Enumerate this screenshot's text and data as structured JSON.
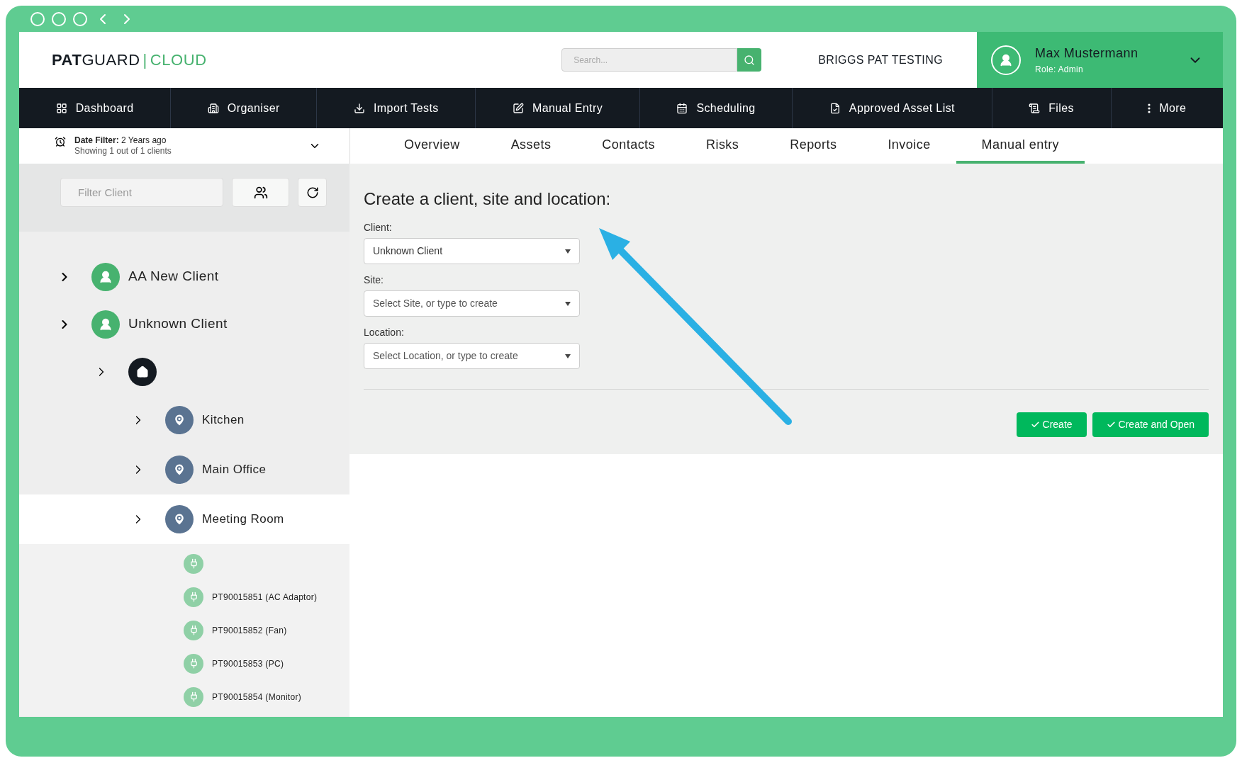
{
  "header": {
    "logo": {
      "name": "**PAT**GUARD",
      "separator": "|",
      "product": "CLOUD"
    },
    "search": {
      "placeholder": "Search..."
    },
    "company": "BRIGGS PAT TESTING",
    "user": {
      "name": "Max Mustermann",
      "role": "Role: Admin"
    }
  },
  "nav": [
    "Dashboard",
    "Organiser",
    "Import Tests",
    "Manual Entry",
    "Scheduling",
    "Approved Asset List",
    "Files",
    "More"
  ],
  "date_filter": {
    "label": "Date Filter:",
    "value": "2 Years ago",
    "summary": "Showing 1 out of 1 clients"
  },
  "tabs": [
    {
      "label": "Overview",
      "selected": false
    },
    {
      "label": "Assets",
      "selected": false
    },
    {
      "label": "Contacts",
      "selected": false
    },
    {
      "label": "Risks",
      "selected": false
    },
    {
      "label": "Reports",
      "selected": false
    },
    {
      "label": "Invoice",
      "selected": false
    },
    {
      "label": "Manual entry",
      "selected": true
    }
  ],
  "sidebar": {
    "filter": {
      "placeholder": "Filter Client"
    },
    "tree": [
      {
        "kind": "client",
        "label": "AA New Client",
        "selected": false
      },
      {
        "kind": "client",
        "label": "Unknown Client",
        "selected": false,
        "children": [
          {
            "kind": "site",
            "selected": false,
            "children": [
              {
                "kind": "location",
                "label": "Kitchen",
                "selected": false
              },
              {
                "kind": "location",
                "label": "Main Office",
                "selected": false
              },
              {
                "kind": "location",
                "label": "Meeting Room",
                "selected": true,
                "children": [
                  {
                    "kind": "asset",
                    "selected": false
                  },
                  {
                    "kind": "asset",
                    "label": "PT90015851 (AC Adaptor)",
                    "selected": false
                  },
                  {
                    "kind": "asset",
                    "label": "PT90015852 (Fan)",
                    "selected": false
                  },
                  {
                    "kind": "asset",
                    "label": "PT90015853 (PC)",
                    "selected": false
                  },
                  {
                    "kind": "asset",
                    "label": "PT90015854 (Monitor)",
                    "selected": false
                  }
                ]
              }
            ]
          }
        ]
      }
    ]
  },
  "form": {
    "title": "Create a client, site and location:",
    "fields": [
      {
        "label": "Client:",
        "value": "Unknown Client"
      },
      {
        "label": "Site:",
        "placeholder": "Select Site, or type to create"
      },
      {
        "label": "Location:",
        "placeholder": "Select Location, or type to create"
      }
    ],
    "buttons": [
      "Create",
      "Create and Open"
    ]
  }
}
